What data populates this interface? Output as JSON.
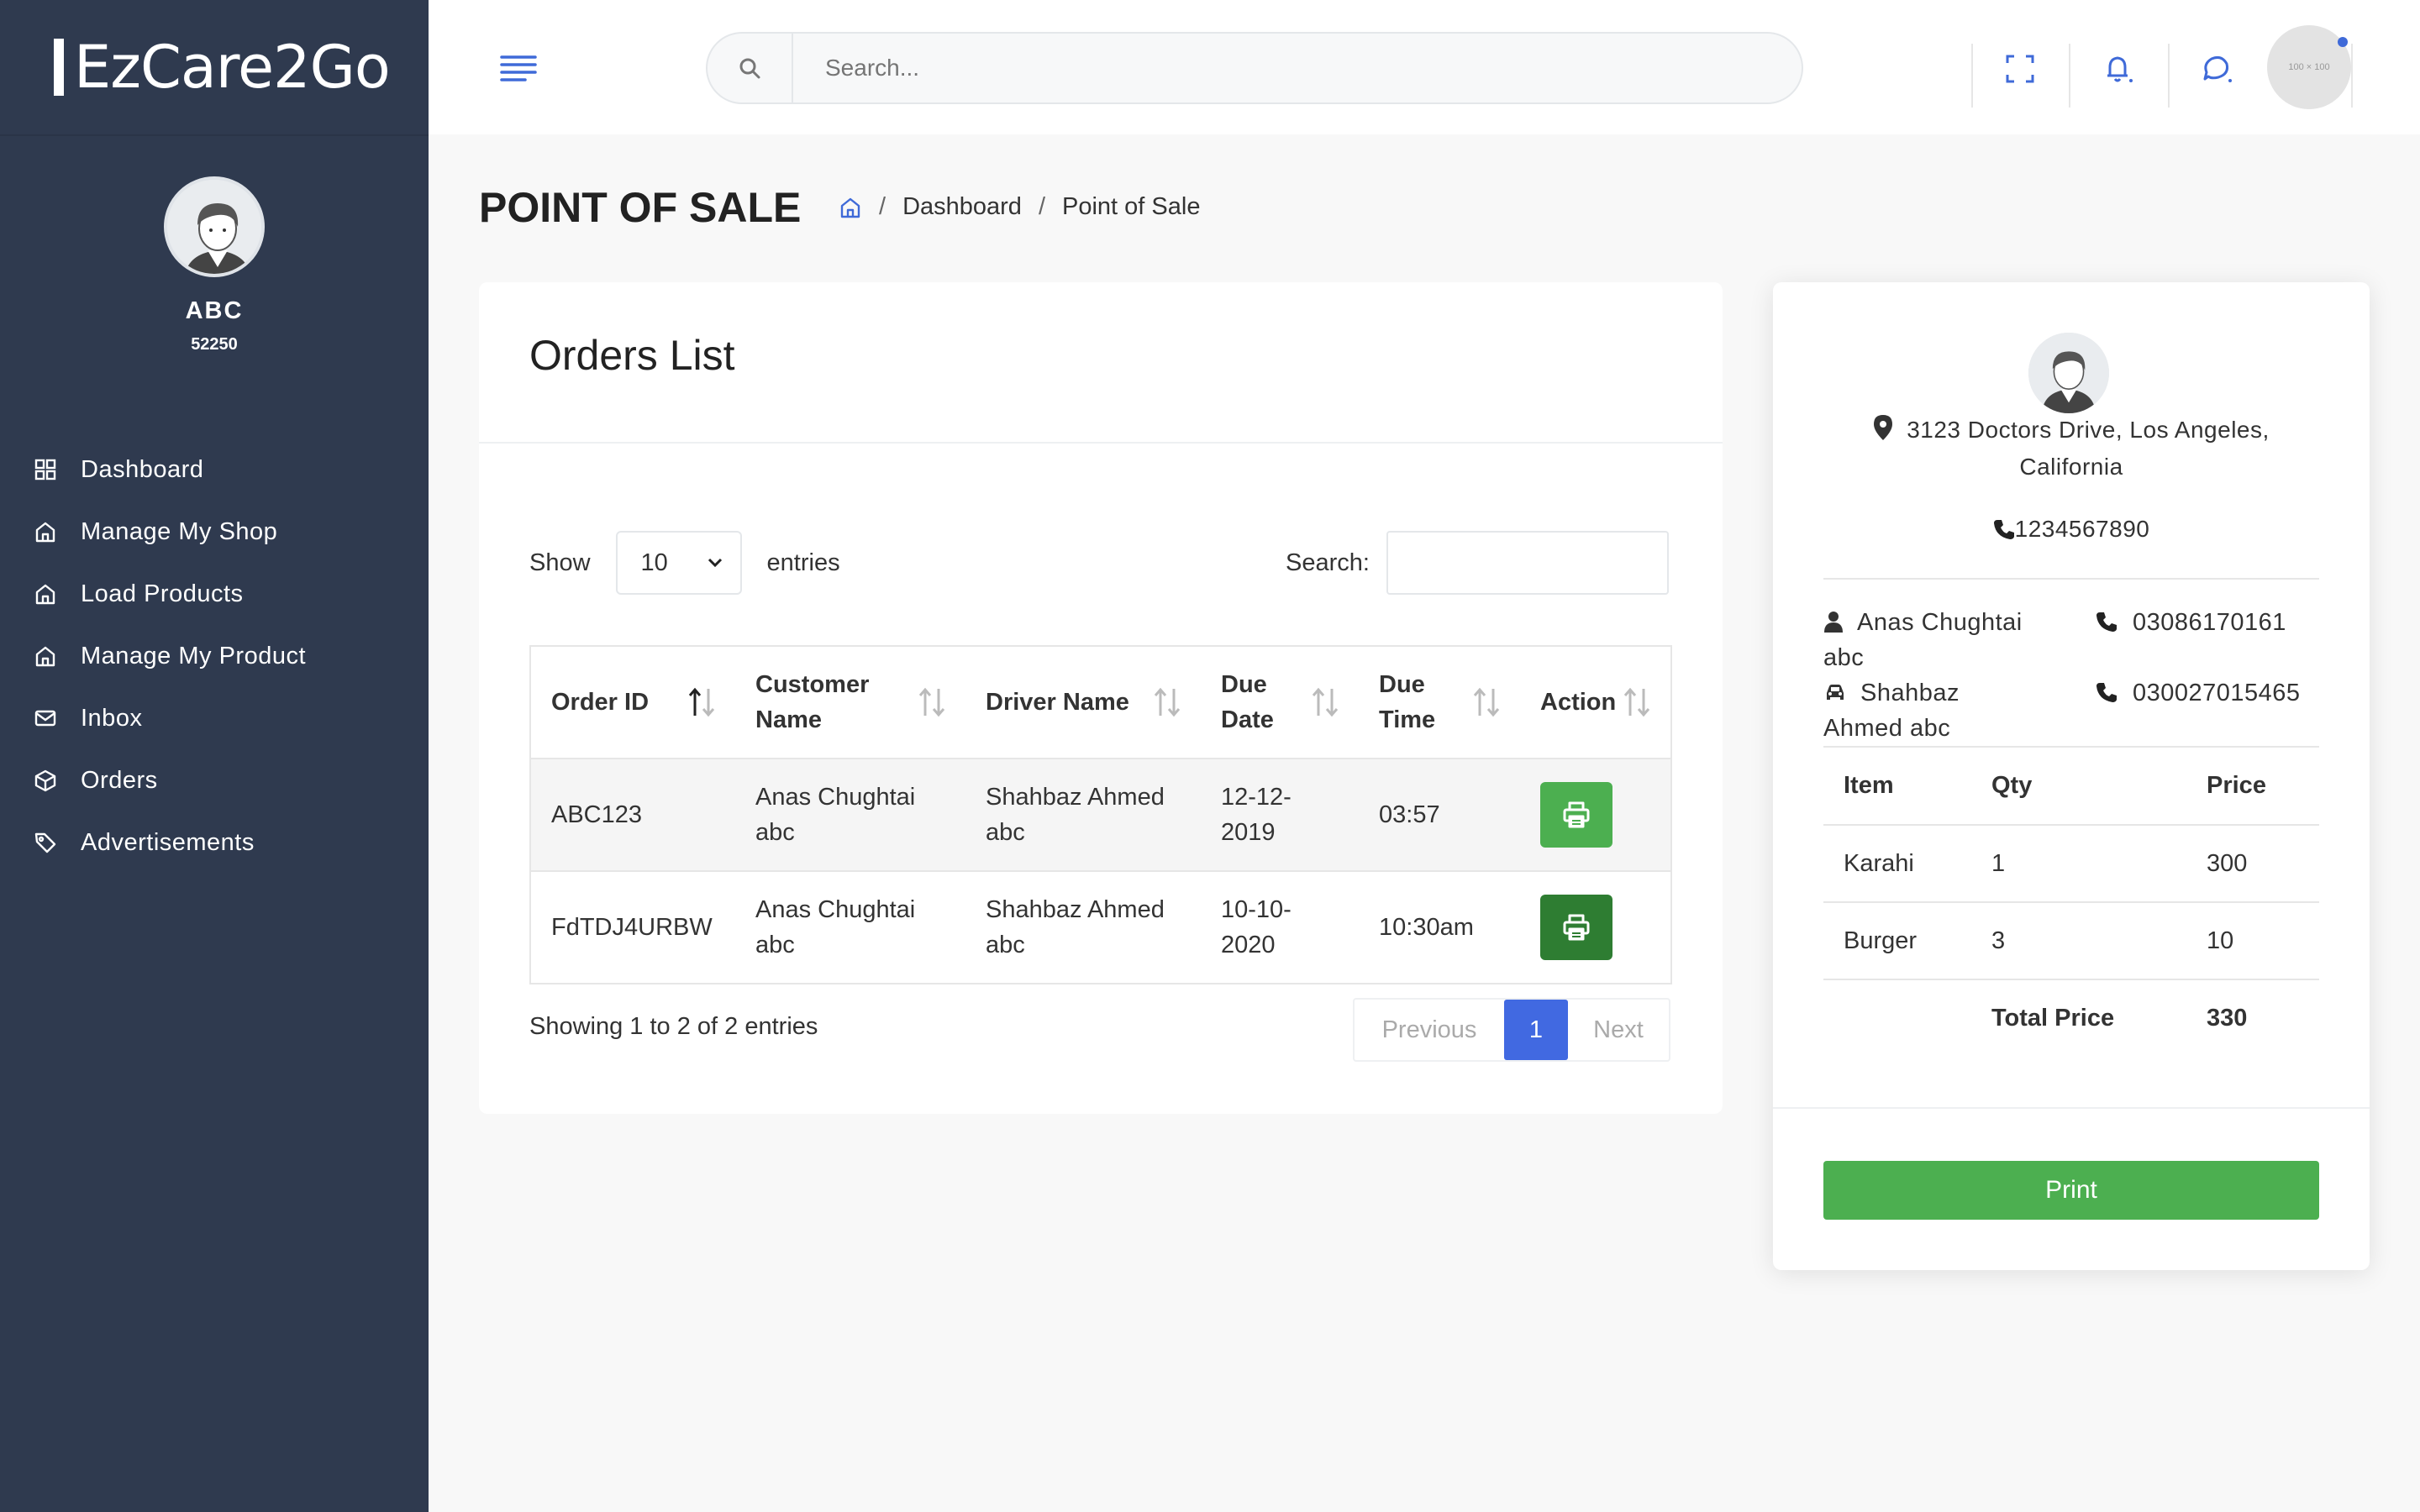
{
  "brand": {
    "name": "EzCare2Go"
  },
  "profile": {
    "name": "ABC",
    "code": "52250"
  },
  "sidebar": {
    "items": [
      {
        "label": "Dashboard",
        "icon": "grid-icon"
      },
      {
        "label": "Manage My Shop",
        "icon": "home-icon"
      },
      {
        "label": "Load Products",
        "icon": "home-icon"
      },
      {
        "label": "Manage My Product",
        "icon": "home-icon"
      },
      {
        "label": "Inbox",
        "icon": "envelope-icon"
      },
      {
        "label": "Orders",
        "icon": "box-icon"
      },
      {
        "label": "Advertisements",
        "icon": "tag-icon"
      }
    ]
  },
  "topbar": {
    "search_placeholder": "Search...",
    "avatar_text": "100 × 100",
    "accent": "#3f6ad8"
  },
  "page": {
    "title": "POINT OF SALE",
    "breadcrumb": [
      "Dashboard",
      "Point of Sale"
    ]
  },
  "orders": {
    "title": "Orders List",
    "show_label": "Show",
    "entries_value": "10",
    "entries_label": "entries",
    "search_label": "Search:",
    "columns": [
      "Order ID",
      "Customer Name",
      "Driver Name",
      "Due Date",
      "Due Time",
      "Action"
    ],
    "rows": [
      {
        "order_id": "ABC123",
        "customer": "Anas Chughtai abc",
        "driver": "Shahbaz Ahmed abc",
        "due_date": "12-12-2019",
        "due_time": "03:57",
        "btn_color": "#4caf50"
      },
      {
        "order_id": "FdTDJ4URBW",
        "customer": "Anas Chughtai abc",
        "driver": "Shahbaz Ahmed abc",
        "due_date": "10-10-2020",
        "due_time": "10:30am",
        "btn_color": "#2e7d32"
      }
    ],
    "info": "Showing 1 to 2 of 2 entries",
    "pager": {
      "previous": "Previous",
      "current": "1",
      "next": "Next"
    }
  },
  "receipt": {
    "address": "3123 Doctors Drive, Los Angeles, California",
    "phone": "1234567890",
    "customer": {
      "name": "Anas Chughtai abc",
      "phone": "03086170161"
    },
    "driver": {
      "name": "Shahbaz Ahmed abc",
      "phone": "030027015465"
    },
    "columns": [
      "Item",
      "Qty",
      "Price"
    ],
    "items": [
      {
        "item": "Karahi",
        "qty": "1",
        "price": "300"
      },
      {
        "item": "Burger",
        "qty": "3",
        "price": "10"
      }
    ],
    "total_label": "Total Price",
    "total_value": "330",
    "print_label": "Print"
  }
}
